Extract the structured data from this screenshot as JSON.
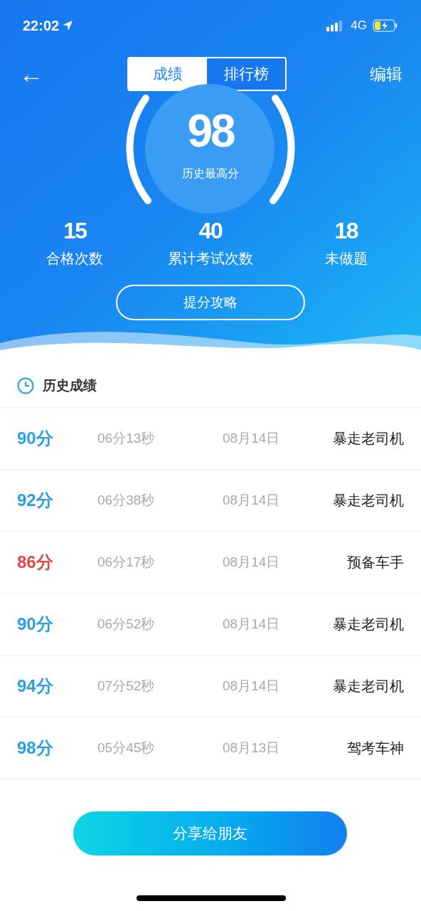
{
  "status_bar": {
    "time": "22:02",
    "network": "4G"
  },
  "nav": {
    "back": "←",
    "edit": "编辑"
  },
  "tabs": [
    {
      "label": "成绩",
      "selected": true
    },
    {
      "label": "排行榜",
      "selected": false
    }
  ],
  "gauge": {
    "score": "98",
    "caption": "历史最高分"
  },
  "stats": [
    {
      "value": "15",
      "label": "合格次数"
    },
    {
      "value": "40",
      "label": "累计考试次数"
    },
    {
      "value": "18",
      "label": "未做题"
    }
  ],
  "tips_button": "提分攻略",
  "history": {
    "title": "历史成绩",
    "rows": [
      {
        "score": "90分",
        "passed": true,
        "duration": "06分13秒",
        "date": "08月14日",
        "title": "暴走老司机"
      },
      {
        "score": "92分",
        "passed": true,
        "duration": "06分38秒",
        "date": "08月14日",
        "title": "暴走老司机"
      },
      {
        "score": "86分",
        "passed": false,
        "duration": "06分17秒",
        "date": "08月14日",
        "title": "预备车手"
      },
      {
        "score": "90分",
        "passed": true,
        "duration": "06分52秒",
        "date": "08月14日",
        "title": "暴走老司机"
      },
      {
        "score": "94分",
        "passed": true,
        "duration": "07分52秒",
        "date": "08月14日",
        "title": "暴走老司机"
      },
      {
        "score": "98分",
        "passed": true,
        "duration": "05分45秒",
        "date": "08月13日",
        "title": "驾考车神"
      }
    ]
  },
  "share_button": "分享给朋友"
}
